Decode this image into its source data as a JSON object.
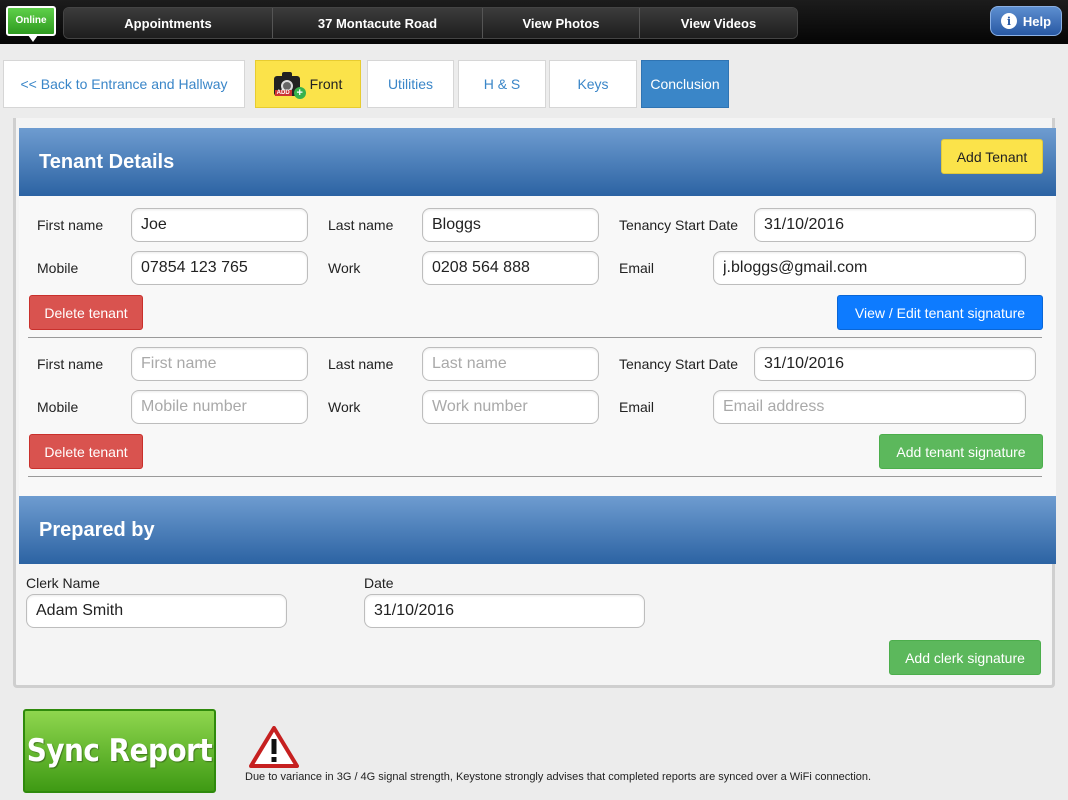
{
  "topbar": {
    "status": "Online",
    "nav": [
      "Appointments",
      "37 Montacute Road",
      "View Photos",
      "View Videos"
    ],
    "help": "Help"
  },
  "tabs": {
    "back": "<< Back to Entrance and Hallway",
    "front": "Front",
    "front_icon_tag": "ADD",
    "utilities": "Utilities",
    "hs": "H & S",
    "keys": "Keys",
    "conclusion": "Conclusion"
  },
  "tenant_details": {
    "title": "Tenant Details",
    "add_tenant": "Add Tenant",
    "labels": {
      "first_name": "First name",
      "last_name": "Last name",
      "start_date": "Tenancy Start Date",
      "mobile": "Mobile",
      "work": "Work",
      "email": "Email"
    },
    "placeholders": {
      "first_name": "First name",
      "last_name": "Last name",
      "mobile": "Mobile number",
      "work": "Work number",
      "email": "Email address"
    },
    "tenants": [
      {
        "first_name": "Joe",
        "last_name": "Bloggs",
        "start_date": "31/10/2016",
        "mobile": "07854 123 765",
        "work": "0208 564 888",
        "email": "j.bloggs@gmail.com",
        "delete": "Delete tenant",
        "signature": "View / Edit tenant signature"
      },
      {
        "first_name": "",
        "last_name": "",
        "start_date": "31/10/2016",
        "mobile": "",
        "work": "",
        "email": "",
        "delete": "Delete tenant",
        "signature": "Add tenant signature"
      }
    ]
  },
  "prepared_by": {
    "title": "Prepared by",
    "clerk_label": "Clerk Name",
    "clerk_name": "Adam Smith",
    "date_label": "Date",
    "date": "31/10/2016",
    "signature": "Add clerk signature"
  },
  "footer": {
    "sync": "Sync Report",
    "warning": "Due to variance in 3G / 4G signal strength, Keystone strongly advises that completed reports are synced over a WiFi connection."
  },
  "colors": {
    "header_blue": "#2c63a3",
    "tab_active": "#3a86c8",
    "tab_front": "#fbe34a",
    "delete_red": "#d9534f",
    "signature_blue": "#0d7bff",
    "signature_green": "#5cb85c",
    "sync_green": "#3f9a14"
  }
}
